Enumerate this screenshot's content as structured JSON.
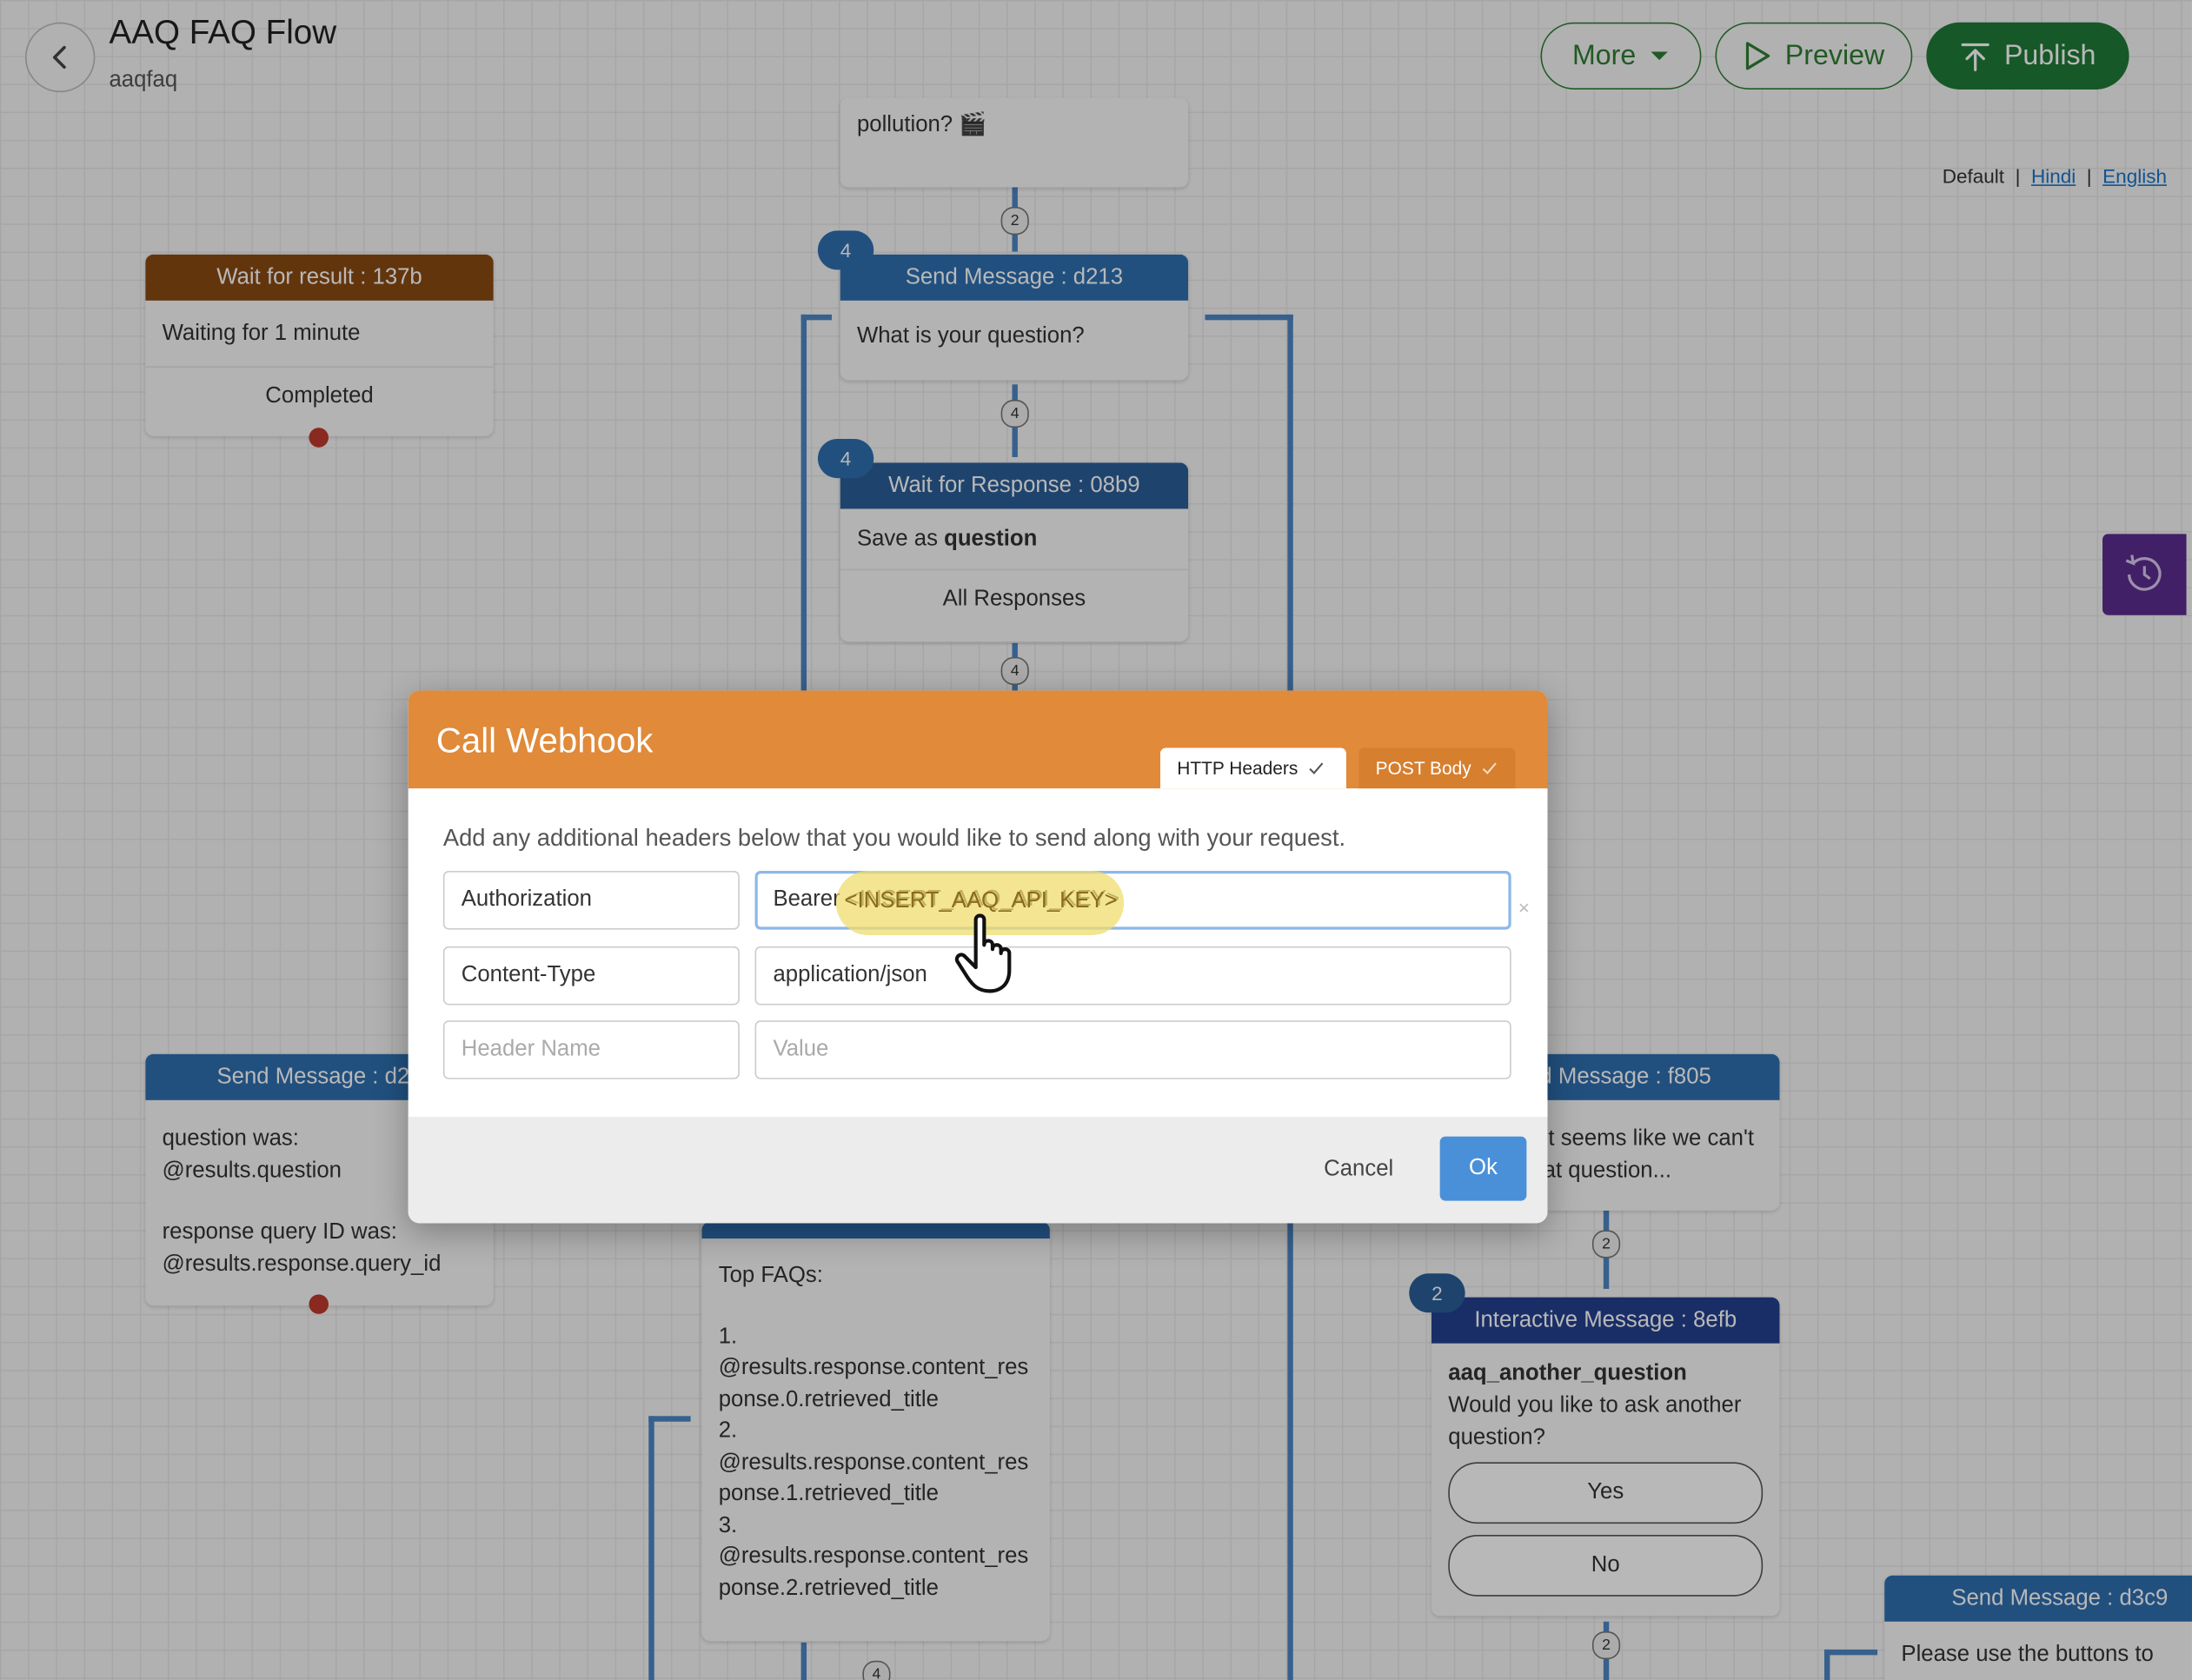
{
  "header": {
    "title": "AAQ FAQ Flow",
    "subtitle": "aaqfaq",
    "more_label": "More",
    "preview_label": "Preview",
    "publish_label": "Publish"
  },
  "languages": {
    "default": "Default",
    "sep": "|",
    "hindi": "Hindi",
    "english": "English"
  },
  "canvas": {
    "top_partial_text": "pollution? 🎬",
    "wait_result": {
      "title": "Wait for result : 137b",
      "body": "Waiting for 1 minute",
      "exit": "Completed"
    },
    "send_d213": {
      "badge": "4",
      "title": "Send Message : d213",
      "body": "What is your question?"
    },
    "wait_response": {
      "badge": "4",
      "title": "Wait for Response : 08b9",
      "body_prefix": "Save as",
      "body_var": "question",
      "exit": "All Responses"
    },
    "send_d2": {
      "title": "Send Message : d2b",
      "line1": "question was:",
      "line2": "@results.question",
      "line3": "response query ID was:",
      "line4": "@results.response.query_id"
    },
    "top_faqs": {
      "lines": [
        "Top FAQs:",
        "1.",
        "@results.response.content_res",
        "ponse.0.retrieved_title",
        "2.",
        "@results.response.content_res",
        "ponse.1.retrieved_title",
        "3.",
        "@results.response.content_res",
        "ponse.2.retrieved_title"
      ]
    },
    "send_f805": {
      "title": "Send Message : f805",
      "line1": "it seems like we can't",
      "line2": "at question..."
    },
    "interactive": {
      "badge": "2",
      "title": "Interactive Message : 8efb",
      "name": "aaq_another_question",
      "question1": "Would you like to ask another",
      "question2": "question?",
      "yes": "Yes",
      "no": "No"
    },
    "send_d3c9": {
      "title": "Send Message : d3c9",
      "body": "Please use the buttons to"
    },
    "counts": {
      "c1": "2",
      "c2": "4",
      "c3": "4",
      "c4": "2",
      "c5": "2",
      "c6": "4"
    }
  },
  "modal": {
    "title": "Call Webhook",
    "tab_headers": "HTTP Headers",
    "tab_body": "POST Body",
    "description": "Add any additional headers below that you would like to send along with your request.",
    "rows": [
      {
        "name": "Authorization",
        "value": "Bearer <INSERT_AAQ_API_KEY>"
      },
      {
        "name": "Content-Type",
        "value": "application/json"
      }
    ],
    "placeholder_name": "Header Name",
    "placeholder_value": "Value",
    "highlight_text": "<INSERT_AAQ_API_KEY>",
    "cancel_label": "Cancel",
    "ok_label": "Ok"
  }
}
